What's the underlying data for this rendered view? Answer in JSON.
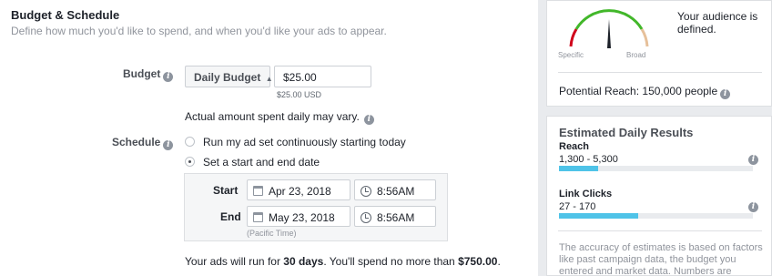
{
  "budget_schedule": {
    "title": "Budget & Schedule",
    "subtitle": "Define how much you'd like to spend, and when you'd like your ads to appear.",
    "budget": {
      "label": "Budget",
      "type_select": "Daily Budget",
      "amount_value": "$25.00",
      "amount_hint": "$25.00 USD",
      "note": "Actual amount spent daily may vary."
    },
    "schedule": {
      "label": "Schedule",
      "options": [
        {
          "label": "Run my ad set continuously starting today",
          "selected": false
        },
        {
          "label": "Set a start and end date",
          "selected": true
        }
      ],
      "start": {
        "label": "Start",
        "date": "Apr 23, 2018",
        "time": "8:56AM"
      },
      "end": {
        "label": "End",
        "date": "May 23, 2018",
        "time": "8:56AM"
      },
      "timezone": "(Pacific Time)"
    },
    "summary": {
      "prefix": "Your ads will run for ",
      "duration": "30 days",
      "middle": ". You'll spend no more than ",
      "max_spend": "$750.00",
      "suffix": "."
    }
  },
  "audience": {
    "gauge_left_label": "Specific",
    "gauge_right_label": "Broad",
    "status": "Your audience is defined.",
    "potential_reach": "Potential Reach: 150,000 people"
  },
  "estimated_results": {
    "title": "Estimated Daily Results",
    "metrics": [
      {
        "name": "Reach",
        "range": "1,300 - 5,300",
        "fill_fraction": 0.2
      },
      {
        "name": "Link Clicks",
        "range": "27 - 170",
        "fill_fraction": 0.41
      }
    ],
    "accuracy_text": "The accuracy of estimates is based on factors like past campaign data, the budget you entered and market data. Numbers are"
  },
  "colors": {
    "accent_bar": "#4fc3e8",
    "gauge_red": "#d0021b",
    "gauge_green": "#42b72a",
    "gauge_tan": "#e6c09a"
  },
  "icons": [
    "info-icon",
    "calendar-icon",
    "clock-icon",
    "dropdown-caret-icon"
  ]
}
